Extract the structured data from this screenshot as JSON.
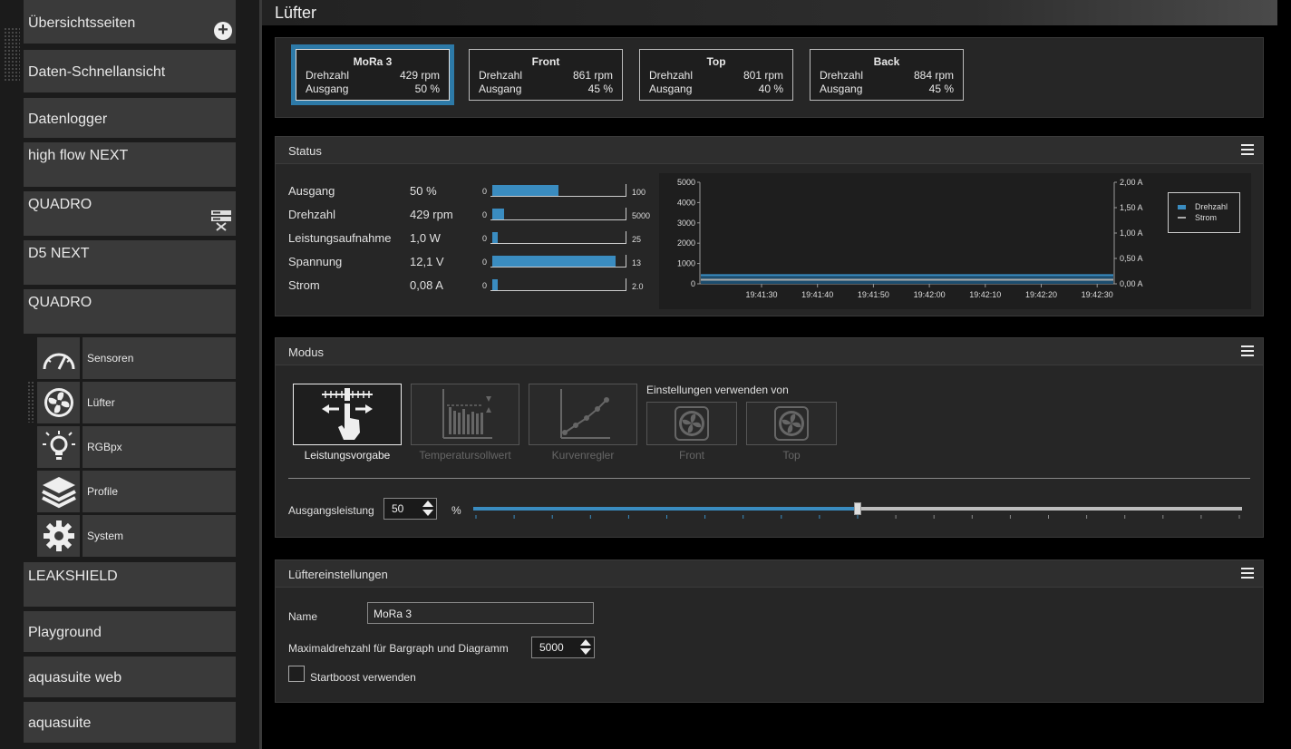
{
  "sidebar": {
    "items": [
      {
        "label": "Übersichtsseiten",
        "top": 0,
        "height": 48
      },
      {
        "label": "Daten-Schnellansicht",
        "top": 55,
        "height": 47
      },
      {
        "label": "Datenlogger",
        "top": 108,
        "height": 44
      },
      {
        "label": "high flow NEXT",
        "top": 157,
        "height": 49
      },
      {
        "label": "QUADRO",
        "top": 211,
        "height": 49
      },
      {
        "label": "D5 NEXT",
        "top": 265,
        "height": 49
      },
      {
        "label": "QUADRO",
        "top": 319,
        "height": 49
      },
      {
        "label": "LEAKSHIELD",
        "top": 620,
        "height": 49
      },
      {
        "label": "Playground",
        "top": 674,
        "height": 45
      },
      {
        "label": "aquasuite web",
        "top": 724,
        "height": 45
      },
      {
        "label": "aquasuite",
        "top": 774,
        "height": 45
      }
    ],
    "sub_items": [
      {
        "label": "Sensoren",
        "icon": "gauge-icon"
      },
      {
        "label": "Lüfter",
        "icon": "fan-icon"
      },
      {
        "label": "RGBpx",
        "icon": "lightbulb-icon"
      },
      {
        "label": "Profile",
        "icon": "layers-icon"
      },
      {
        "label": "System",
        "icon": "gear-icon"
      }
    ]
  },
  "header": {
    "title": "Lüfter"
  },
  "fans": [
    {
      "name": "MoRa 3",
      "rpm_label": "Drehzahl",
      "rpm": "429 rpm",
      "out_label": "Ausgang",
      "out": "50 %",
      "active": true
    },
    {
      "name": "Front",
      "rpm_label": "Drehzahl",
      "rpm": "861 rpm",
      "out_label": "Ausgang",
      "out": "45 %",
      "active": false
    },
    {
      "name": "Top",
      "rpm_label": "Drehzahl",
      "rpm": "801 rpm",
      "out_label": "Ausgang",
      "out": "40 %",
      "active": false
    },
    {
      "name": "Back",
      "rpm_label": "Drehzahl",
      "rpm": "884 rpm",
      "out_label": "Ausgang",
      "out": "45 %",
      "active": false
    }
  ],
  "status": {
    "title": "Status",
    "rows": [
      {
        "label": "Ausgang",
        "value": "50 %",
        "min": "0",
        "max": "100",
        "fraction": 0.5
      },
      {
        "label": "Drehzahl",
        "value": "429 rpm",
        "min": "0",
        "max": "5000",
        "fraction": 0.086
      },
      {
        "label": "Leistungsaufnahme",
        "value": "1,0 W",
        "min": "0",
        "max": "25",
        "fraction": 0.04
      },
      {
        "label": "Spannung",
        "value": "12,1 V",
        "min": "0",
        "max": "13",
        "fraction": 0.93
      },
      {
        "label": "Strom",
        "value": "0,08 A",
        "min": "0",
        "max": "2.0",
        "fraction": 0.04
      }
    ]
  },
  "chart_data": {
    "type": "line",
    "x": [
      "19:41:30",
      "19:41:40",
      "19:41:50",
      "19:42:00",
      "19:42:10",
      "19:42:20",
      "19:42:30"
    ],
    "y_left_ticks": [
      "0",
      "1000",
      "2000",
      "3000",
      "4000",
      "5000"
    ],
    "y_right_ticks": [
      "0,00 A",
      "0,50 A",
      "1,00 A",
      "1,50 A",
      "2,00 A"
    ],
    "ylim_left": [
      0,
      5000
    ],
    "ylim_right": [
      0,
      2.0
    ],
    "series": [
      {
        "name": "Drehzahl",
        "color": "#3a8cc0",
        "values": [
          429,
          429,
          429,
          429,
          429,
          429,
          429
        ]
      },
      {
        "name": "Strom",
        "color": "#aaaaaa",
        "values": [
          0.08,
          0.08,
          0.08,
          0.08,
          0.08,
          0.08,
          0.08
        ]
      }
    ],
    "legend": "top-right"
  },
  "modus": {
    "title": "Modus",
    "modes": [
      "Leistungsvorgabe",
      "Temperatursollwert",
      "Kurvenregler"
    ],
    "einstellungen_label": "Einstellungen verwenden von",
    "use_from": [
      "Front",
      "Top"
    ],
    "ausgang_label": "Ausgangsleistung",
    "ausgang_value": "50",
    "unit": "%",
    "slider_fraction": 0.5
  },
  "settings": {
    "title": "Lüftereinstellungen",
    "name_label": "Name",
    "name_value": "MoRa 3",
    "max_label": "Maximaldrehzahl für Bargraph und Diagramm",
    "max_value": "5000",
    "startboost_label": "Startboost verwenden"
  },
  "colors": {
    "accent": "#3a8cc0",
    "active_border": "#2d7aa8"
  }
}
